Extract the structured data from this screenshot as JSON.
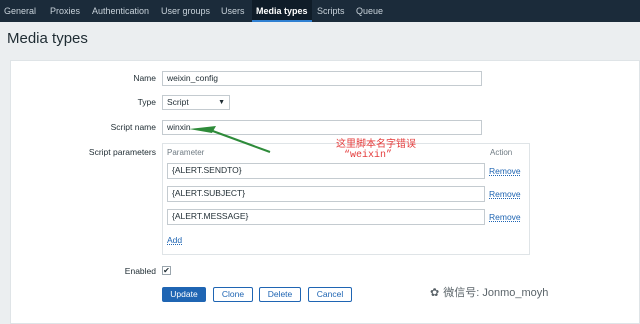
{
  "nav": {
    "tabs": [
      {
        "label": "General"
      },
      {
        "label": "Proxies"
      },
      {
        "label": "Authentication"
      },
      {
        "label": "User groups"
      },
      {
        "label": "Users"
      },
      {
        "label": "Media types",
        "active": true
      },
      {
        "label": "Scripts"
      },
      {
        "label": "Queue"
      }
    ]
  },
  "page": {
    "title": "Media types"
  },
  "form": {
    "name_label": "Name",
    "name_value": "weixin_config",
    "type_label": "Type",
    "type_value": "Script",
    "script_name_label": "Script name",
    "script_name_value": "winxin",
    "params_label": "Script parameters",
    "param_header": "Parameter",
    "action_header": "Action",
    "params": [
      {
        "value": "{ALERT.SENDTO}",
        "remove": "Remove"
      },
      {
        "value": "{ALERT.SUBJECT}",
        "remove": "Remove"
      },
      {
        "value": "{ALERT.MESSAGE}",
        "remove": "Remove"
      }
    ],
    "add_label": "Add",
    "enabled_label": "Enabled",
    "enabled_check": "✔"
  },
  "buttons": {
    "update": "Update",
    "clone": "Clone",
    "delete": "Delete",
    "cancel": "Cancel"
  },
  "annotation": {
    "line1": "这里脚本名字错误",
    "line2": "“weixin”"
  },
  "watermark": {
    "text": "微信号: Jonmo_moyh"
  },
  "colors": {
    "nav_bg": "#1b2b3a",
    "accent": "#1f65b3",
    "annotation": "#e43d3d",
    "arrow": "#2e8b3a"
  }
}
